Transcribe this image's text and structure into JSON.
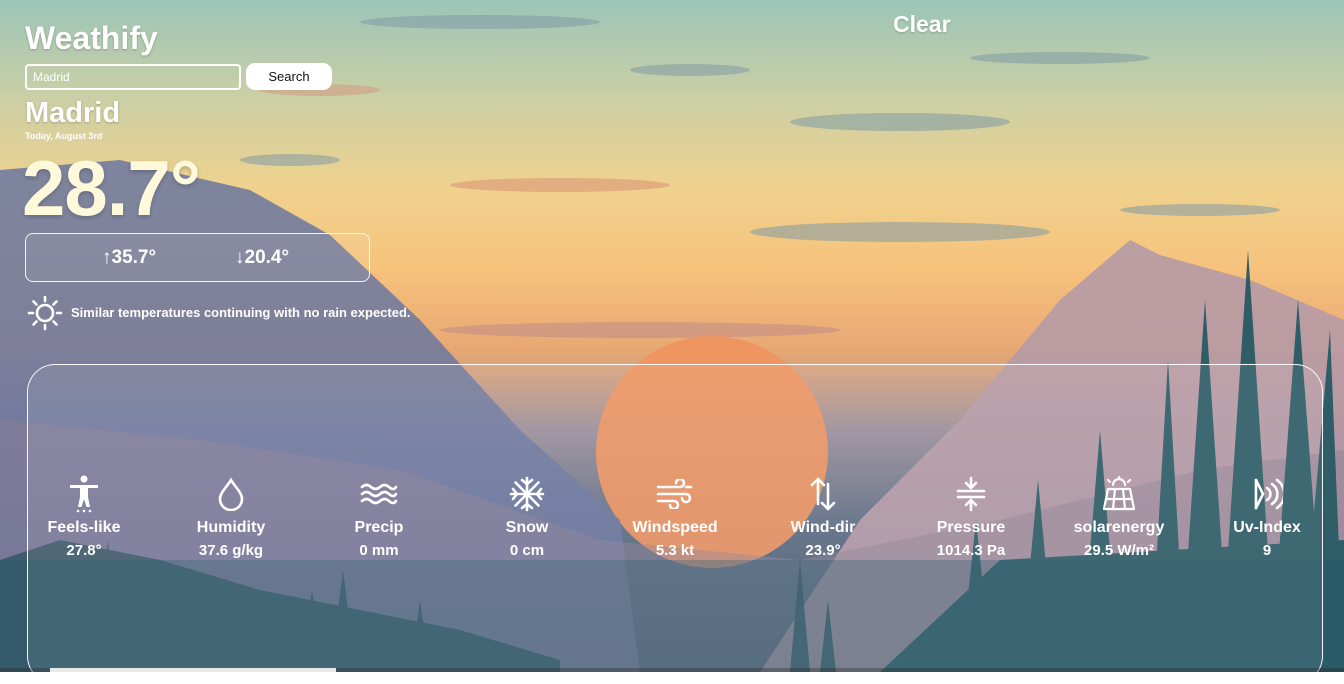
{
  "app": {
    "title": "Weathify"
  },
  "search": {
    "value": "Madrid",
    "button_label": "Search"
  },
  "current": {
    "condition": "Clear",
    "city": "Madrid",
    "date": "Today, August 3rd",
    "temperature": "28.7°",
    "high": "↑35.7°",
    "low": "↓20.4°",
    "description": "Similar temperatures continuing with no rain expected.",
    "description_icon": "sun-icon"
  },
  "stats": [
    {
      "icon": "person-icon",
      "label": "Feels-like",
      "value": "27.8°"
    },
    {
      "icon": "droplet-icon",
      "label": "Humidity",
      "value": "37.6 g/kg"
    },
    {
      "icon": "waves-icon",
      "label": "Precip",
      "value": "0 mm"
    },
    {
      "icon": "snowflake-icon",
      "label": "Snow",
      "value": "0 cm"
    },
    {
      "icon": "wind-icon",
      "label": "Windspeed",
      "value": "5.3 kt"
    },
    {
      "icon": "arrows-updown-icon",
      "label": "Wind-dir",
      "value": "23.9°"
    },
    {
      "icon": "compress-icon",
      "label": "Pressure",
      "value": "1014.3 Pa"
    },
    {
      "icon": "solar-panel-icon",
      "label": "solarenergy",
      "value": "29.5 W/m²"
    },
    {
      "icon": "uv-signal-icon",
      "label": "Uv-Index",
      "value": "9"
    }
  ],
  "colors": {
    "text": "#ffffff",
    "temperature": "#fff9dc",
    "sun": "#f0935e"
  }
}
